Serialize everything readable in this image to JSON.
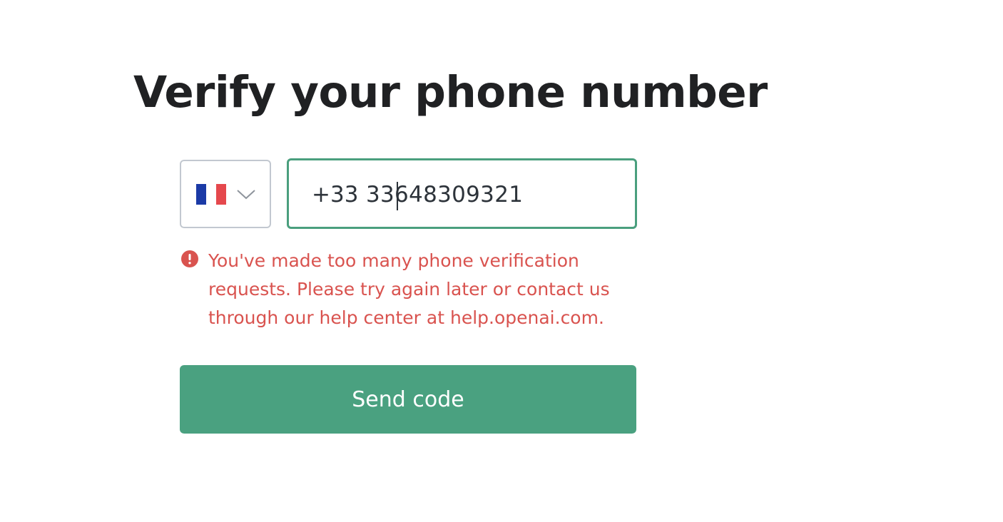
{
  "header": {
    "title": "Verify your phone number"
  },
  "country_selector": {
    "selected_country": "France",
    "flag_icon": "flag-france-icon",
    "flag_colors": [
      "#1b3aa6",
      "#ffffff",
      "#e5484d"
    ],
    "chevron_icon": "chevron-down-icon"
  },
  "phone": {
    "dial_code": "+33",
    "value": "33648309321"
  },
  "error": {
    "icon": "alert-circle-icon",
    "message": "You've made too many phone verification requests. Please try again later or contact us through our help center at help.openai.com."
  },
  "actions": {
    "send_code_label": "Send code"
  },
  "colors": {
    "accent": "#4aa180",
    "focus_border": "#4a9f7e",
    "error": "#d9534f",
    "title": "#202123"
  }
}
